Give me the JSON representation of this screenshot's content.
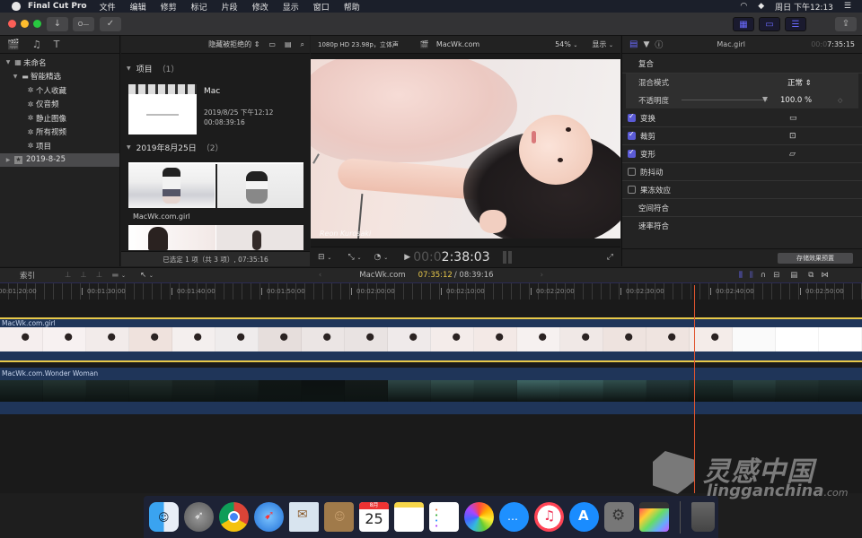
{
  "menubar": {
    "app_name": "Final Cut Pro",
    "items": [
      "文件",
      "编辑",
      "修剪",
      "标记",
      "片段",
      "修改",
      "显示",
      "窗口",
      "帮助"
    ],
    "clock": "周日 下午12:13"
  },
  "toolbar": {
    "import_icon": "↓",
    "keyword_icon": "O—",
    "check_icon": "✓",
    "share_icon": "⇪"
  },
  "libraries": {
    "items": [
      {
        "label": "未命名",
        "icon": "grid-icon",
        "level": 0,
        "expanded": true
      },
      {
        "label": "智能精选",
        "icon": "folder-icon",
        "level": 1,
        "expanded": true
      },
      {
        "label": "个人收藏",
        "icon": "gear-icon",
        "level": 2
      },
      {
        "label": "仅音频",
        "icon": "gear-icon",
        "level": 2
      },
      {
        "label": "静止图像",
        "icon": "gear-icon",
        "level": 2
      },
      {
        "label": "所有视频",
        "icon": "gear-icon",
        "level": 2
      },
      {
        "label": "项目",
        "icon": "gear-icon",
        "level": 2
      },
      {
        "label": "2019-8-25",
        "icon": "star-event-icon",
        "level": 0,
        "selected": true
      }
    ]
  },
  "browser": {
    "filter_label": "隐藏被拒绝的",
    "section1": {
      "title": "项目",
      "count": "（1）"
    },
    "project": {
      "name": "Mac",
      "date": "2019/8/25 下午12:12",
      "duration": "00:08:39:16"
    },
    "section2": {
      "title": "2019年8月25日",
      "count": "（2）"
    },
    "clip1_name": "MacWk.com.girl",
    "footer": "已选定 1 项（共 3 项）, 07:35:16"
  },
  "viewer": {
    "format": "1080p HD 23.98p，立体声",
    "title": "MacWk.com",
    "zoom": "54%",
    "display": "显示",
    "watermark_text": "Reon Kurosaki",
    "timecode_dim": "00:0",
    "timecode": "2:38:03"
  },
  "inspector": {
    "clip_name": "Mac.girl",
    "time_dim": "00:0",
    "time": "7:35:15",
    "composite_label": "复合",
    "blend_label": "混合模式",
    "blend_value": "正常",
    "opacity_label": "不透明度",
    "opacity_value": "100.0 %",
    "opacity_fraction": 1.0,
    "effects": [
      {
        "label": "变换",
        "checked": true,
        "icon": "▭"
      },
      {
        "label": "裁剪",
        "checked": true,
        "icon": "⊡"
      },
      {
        "label": "变形",
        "checked": true,
        "icon": "▱"
      },
      {
        "label": "防抖动",
        "checked": false
      },
      {
        "label": "果冻效应",
        "checked": false
      },
      {
        "label": "空间符合",
        "checked": null
      },
      {
        "label": "速率符合",
        "checked": null
      }
    ],
    "save_preset": "存储效果预置"
  },
  "timeline": {
    "index_label": "索引",
    "project_name": "MacWk.com",
    "current_time": "07:35:12",
    "total_time": "/ 08:39:16",
    "ruler": [
      "00:01:20:00",
      "00:01:30:00",
      "00:01:40:00",
      "00:01:50:00",
      "00:02:00:00",
      "00:02:10:00",
      "00:02:20:00",
      "00:02:30:00",
      "00:02:40:00",
      "00:02:50:00"
    ],
    "track1_name": "MacWk.com.girl",
    "track2_name": "MacWk.com.Wonder Woman"
  },
  "dock": {
    "apps": [
      "Finder",
      "Launchpad",
      "Chrome",
      "Safari",
      "Mail",
      "Contacts",
      "Calendar",
      "Notes",
      "Reminders",
      "Photos",
      "Messages",
      "iTunes",
      "App Store",
      "System Preferences",
      "Final Cut Pro",
      "Trash"
    ],
    "calendar_day": "25",
    "calendar_month": "8月"
  },
  "watermark": {
    "cn": "灵感中国",
    "en": "lingganchina",
    "suffix": ".com"
  },
  "colors": {
    "accent": "#5b5bd6",
    "timecode_yellow": "#e8c84a",
    "playhead": "#e0552f",
    "track": "#1f3559"
  }
}
